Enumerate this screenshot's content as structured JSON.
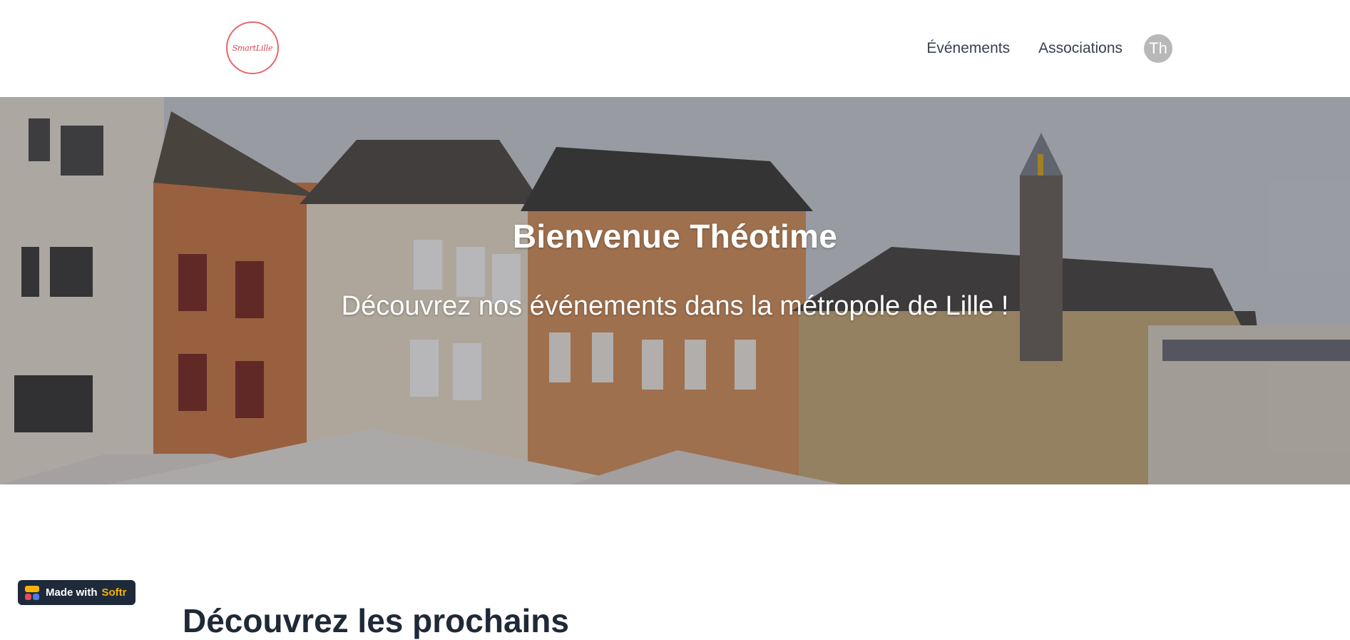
{
  "header": {
    "logo_text": "SmartLille",
    "nav": [
      {
        "label": "Événements"
      },
      {
        "label": "Associations"
      }
    ],
    "avatar_initials": "Th"
  },
  "hero": {
    "title": "Bienvenue Théotime",
    "subtitle": "Découvrez nos événements dans la métropole de Lille !"
  },
  "section": {
    "title": "Découvrez les prochains"
  },
  "badge": {
    "made_with": "Made with",
    "brand": "Softr"
  },
  "colors": {
    "logo_accent": "#e8676a",
    "badge_bg": "#1e2a3a",
    "badge_brand": "#f5b301",
    "avatar_bg": "#b8b8b8"
  }
}
